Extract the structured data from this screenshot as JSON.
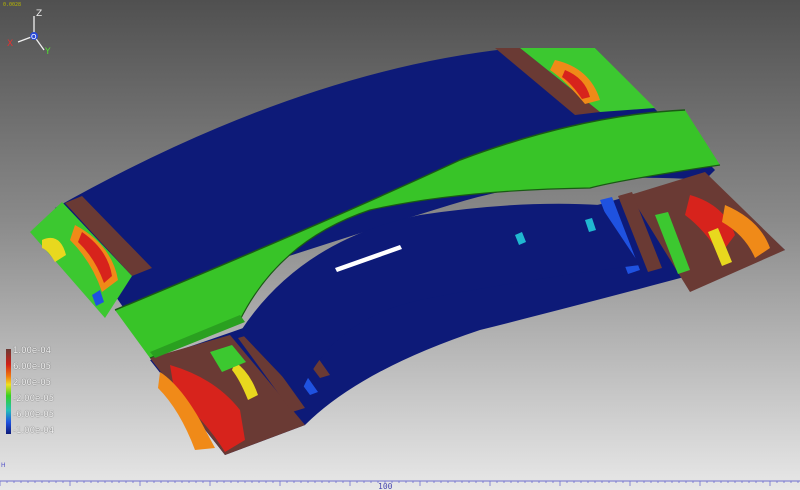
{
  "viewport": {
    "tiny_label": "0.0028",
    "axes": {
      "z": "Z",
      "x": "X",
      "y": "Y",
      "origin": "O"
    }
  },
  "legend": {
    "entries": [
      {
        "label": "1.00e-04",
        "color": "#6a3a34"
      },
      {
        "label": "6.00e-05",
        "color": "#e21f1a"
      },
      {
        "label": "2.00e-05",
        "color": "#36d023"
      },
      {
        "label": "-2.00e-05",
        "color": "#22c0b8"
      },
      {
        "label": "-6.00e-05",
        "color": "#1f52e0"
      },
      {
        "label": "-1.00e-04",
        "color": "#0d1a78"
      }
    ],
    "gradient": [
      "#6a3a34",
      "#d02018",
      "#f07a10",
      "#f0e020",
      "#36d023",
      "#22c0b8",
      "#1f52e0",
      "#0d1a78"
    ]
  },
  "ruler": {
    "scale_label": "100",
    "marker": "H"
  },
  "colors": {
    "navy": "#0d1a78",
    "green": "#38c428",
    "brown": "#6a3a34",
    "red": "#d7231c",
    "orange": "#f08a18",
    "yellow": "#e8d81e",
    "cyan": "#20b8d0"
  }
}
